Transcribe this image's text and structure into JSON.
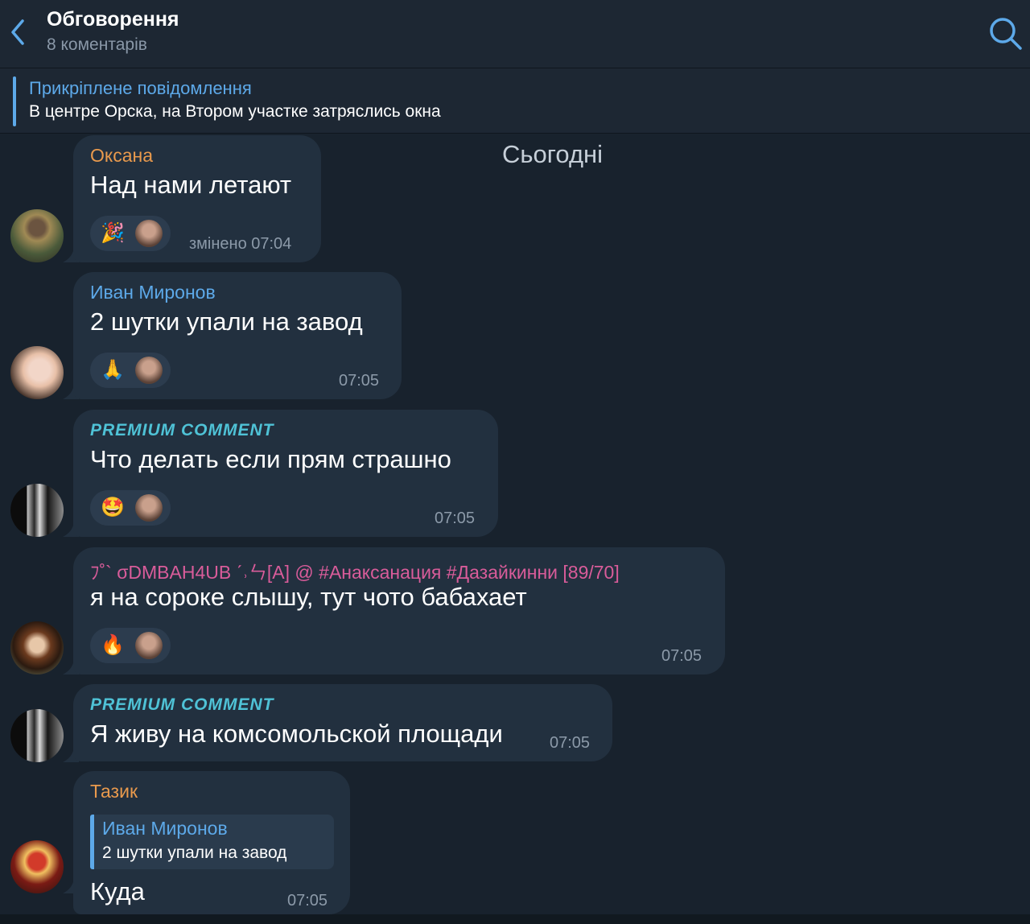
{
  "header": {
    "title": "Обговорення",
    "subtitle": "8 коментарів",
    "back_icon": "chevron-left-icon",
    "search_icon": "search-icon"
  },
  "pinned": {
    "title": "Прикріплене повідомлення",
    "text": "В центре Орска, на Втором участке затряслись окна"
  },
  "date_separator": "Сьогодні",
  "colors": {
    "accent": "#5da9e9",
    "background": "#18222d",
    "bubble": "#22303f",
    "name_orange": "#e99a4d",
    "name_blue": "#5da9e9",
    "name_pink": "#d95c9a",
    "premium": "#4fc2d6"
  },
  "messages": [
    {
      "author": "Оксана",
      "text": "Над нами летают",
      "reaction_emoji": "🎉",
      "time": "змінено 07:04"
    },
    {
      "author": "Иван Миронов",
      "text": "2 шутки упали на завод",
      "reaction_emoji": "🙏",
      "time": "07:05"
    },
    {
      "author": "PREMIUM COMMENT",
      "text": "Что делать если прям страшно",
      "reaction_emoji": "🤩",
      "time": "07:05"
    },
    {
      "author": "ﾌ˚` σDMBAH4UB ˊ˒ㄣ[A] @ #Анаксанация #Дазайкинни [89/70]",
      "text": "я на сороке слышу, тут чото бабахает",
      "reaction_emoji": "🔥",
      "time": "07:05"
    },
    {
      "author": "PREMIUM COMMENT",
      "text": "Я живу на комсомольской площади",
      "time": "07:05"
    },
    {
      "author": "Тазик",
      "reply_author": "Иван Миронов",
      "reply_text": "2 шутки упали на завод",
      "text": "Куда",
      "time": "07:05"
    }
  ]
}
